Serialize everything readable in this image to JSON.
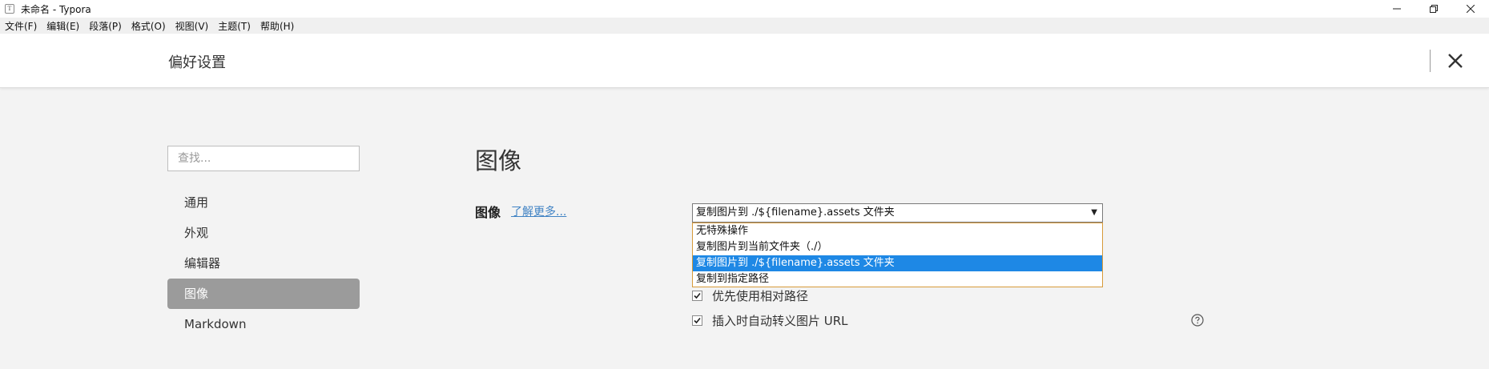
{
  "window": {
    "title": "未命名 - Typora",
    "app_icon_letter": "T",
    "minimize_icon": "minimize-icon",
    "restore_icon": "restore-icon",
    "close_icon": "close-icon"
  },
  "menubar": {
    "items": [
      {
        "label": "文件(F)"
      },
      {
        "label": "编辑(E)"
      },
      {
        "label": "段落(P)"
      },
      {
        "label": "格式(O)"
      },
      {
        "label": "视图(V)"
      },
      {
        "label": "主题(T)"
      },
      {
        "label": "帮助(H)"
      }
    ]
  },
  "header": {
    "title": "偏好设置",
    "close_icon": "close-icon"
  },
  "sidebar": {
    "search_placeholder": "查找...",
    "items": [
      {
        "label": "通用",
        "active": false
      },
      {
        "label": "外观",
        "active": false
      },
      {
        "label": "编辑器",
        "active": false
      },
      {
        "label": "图像",
        "active": true
      },
      {
        "label": "Markdown",
        "active": false
      }
    ]
  },
  "main": {
    "section_title": "图像",
    "image_label": "图像",
    "learn_more": "了解更多...",
    "select": {
      "value": "复制图片到 ./${filename}.assets 文件夹",
      "options": [
        {
          "label": "无特殊操作",
          "selected": false
        },
        {
          "label": "复制图片到当前文件夹（./）",
          "selected": false
        },
        {
          "label": "复制图片到 ./${filename}.assets 文件夹",
          "selected": true
        },
        {
          "label": "复制到指定路径",
          "selected": false
        }
      ]
    },
    "checkboxes": [
      {
        "label": "优先使用相对路径",
        "checked": true
      },
      {
        "label": "插入时自动转义图片 URL",
        "checked": true
      }
    ],
    "help_icon": "question-circle-icon"
  },
  "colors": {
    "accent": "#1e88e5",
    "link": "#4183c4",
    "active_nav": "#9b9b9b",
    "dropdown_border": "#d79a3a"
  }
}
